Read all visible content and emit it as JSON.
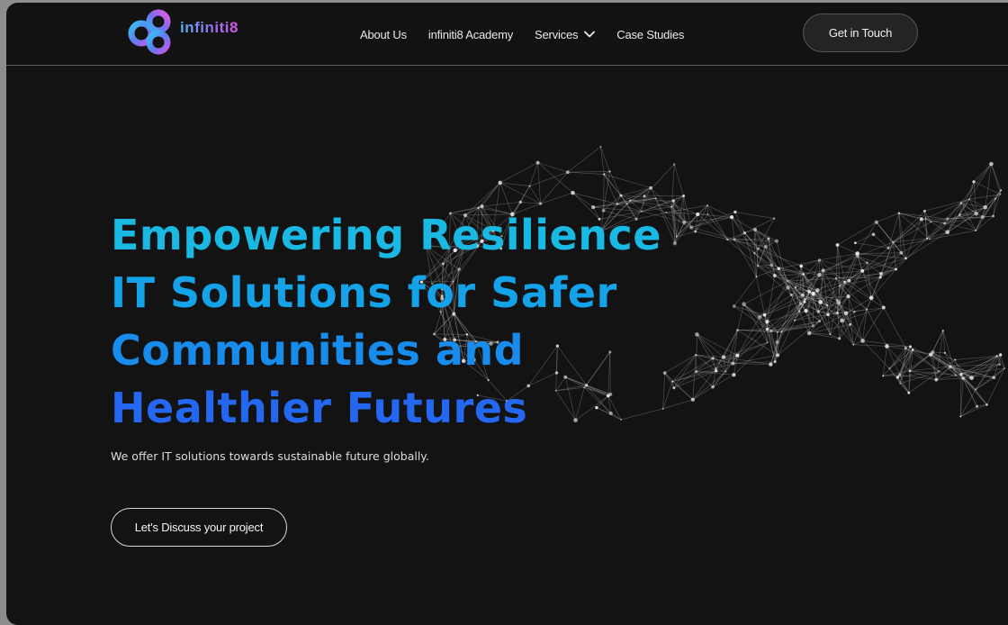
{
  "brand": {
    "name": "infiniti8",
    "logo_icon": "infinity-loop-logo",
    "gradient": [
      "#4ab8ee",
      "#9a6cf0",
      "#d65ae8"
    ]
  },
  "nav": {
    "items": [
      {
        "label": "About Us"
      },
      {
        "label": "infiniti8 Academy"
      },
      {
        "label": "Services",
        "icon": "chevron-down-icon"
      },
      {
        "label": "Case Studies"
      }
    ],
    "cta_label": "Get in Touch"
  },
  "hero": {
    "headline_lines": [
      "Empowering Resilience",
      "IT Solutions for Safer",
      "Communities and",
      "Healthier Futures"
    ],
    "subtitle": "We offer IT solutions towards sustainable future globally.",
    "button_label": "Let's Discuss your project",
    "background_art": "network-mesh-infinity-graphic"
  },
  "colors": {
    "background": "#131313",
    "headline_gradient": [
      "#19b9e4",
      "#2467f0"
    ],
    "text": "#e9e9e9"
  }
}
